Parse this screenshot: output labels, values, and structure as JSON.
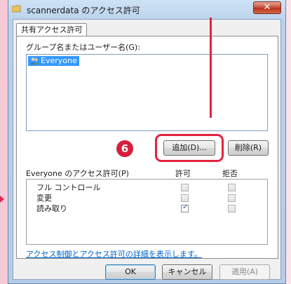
{
  "window": {
    "title": "scannerdata のアクセス許可",
    "close_symbol": "✕"
  },
  "tab": {
    "label": "共有アクセス許可"
  },
  "groups": {
    "label": "グループ名またはユーザー名(G):",
    "items": [
      {
        "label": "Everyone",
        "selected": true
      }
    ]
  },
  "buttons": {
    "add": "追加(D)...",
    "remove": "削除(R)",
    "ok": "OK",
    "cancel": "キャンセル",
    "apply": "適用(A)"
  },
  "annotation": {
    "step_number": "6",
    "color": "#e3223e"
  },
  "permissions": {
    "label": "Everyone のアクセス許可(P)",
    "col_allow": "許可",
    "col_deny": "拒否",
    "rows": [
      {
        "name": "フル コントロール",
        "allow": false,
        "deny": false
      },
      {
        "name": "変更",
        "allow": false,
        "deny": false
      },
      {
        "name": "読み取り",
        "allow": true,
        "deny": false
      }
    ]
  },
  "help_link": "アクセス制御とアクセス許可の詳細を表示します。",
  "icons": {
    "title": "folder-icon",
    "group_item": "users-icon",
    "checked": "checkmark-icon"
  }
}
